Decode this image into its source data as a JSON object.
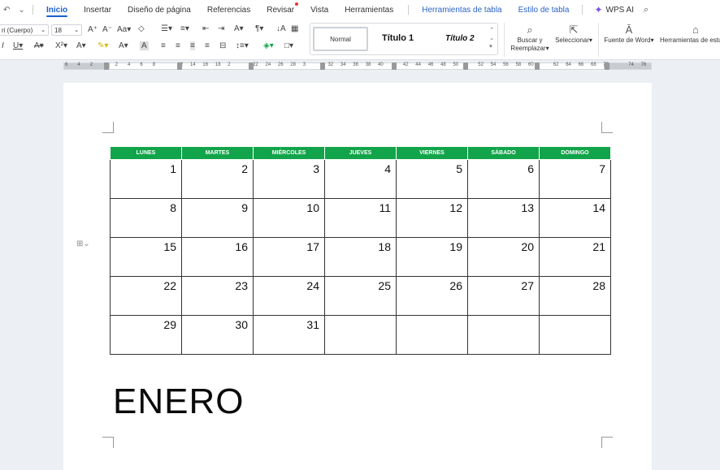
{
  "menubar": {
    "tabs": [
      "Inicio",
      "Insertar",
      "Diseño de página",
      "Referencias",
      "Revisar",
      "Vista",
      "Herramientas"
    ],
    "context_tabs": [
      "Herramientas de tabla",
      "Estilo de tabla"
    ],
    "wps_ai": "WPS AI"
  },
  "ribbon": {
    "font_name": "ri (Cuerpo)",
    "font_size": "18",
    "styles": {
      "normal": "Normal",
      "titulo1": "Título 1",
      "titulo2": "Título 2"
    },
    "buscar_line1": "Buscar y",
    "buscar_line2": "Reemplazar",
    "seleccionar": "Seleccionar",
    "fuente_word": "Fuente de Word",
    "herramientas_estu": "Herramientas de estu"
  },
  "ruler": {
    "numbers": [
      "6",
      "4",
      "2",
      "",
      "2",
      "4",
      "6",
      "8",
      "",
      "12",
      "14",
      "16",
      "18",
      "2",
      "",
      "22",
      "24",
      "26",
      "28",
      "3",
      "",
      "32",
      "34",
      "36",
      "38",
      "40",
      "",
      "42",
      "44",
      "46",
      "48",
      "50",
      "",
      "52",
      "54",
      "56",
      "58",
      "60",
      "",
      "62",
      "64",
      "66",
      "68",
      "70",
      "",
      "74",
      "76"
    ]
  },
  "calendar": {
    "days": [
      "LUNES",
      "MARTES",
      "MIÉRCOLES",
      "JUEVES",
      "VIERNES",
      "SÁBADO",
      "DOMINGO"
    ],
    "weeks": [
      [
        "1",
        "2",
        "3",
        "4",
        "5",
        "6",
        "7"
      ],
      [
        "8",
        "9",
        "10",
        "11",
        "12",
        "13",
        "14"
      ],
      [
        "15",
        "16",
        "17",
        "18",
        "19",
        "20",
        "21"
      ],
      [
        "22",
        "23",
        "24",
        "25",
        "26",
        "27",
        "28"
      ],
      [
        "29",
        "30",
        "31",
        "",
        "",
        "",
        ""
      ]
    ],
    "month": "ENERO",
    "header_color": "#12a44a"
  }
}
